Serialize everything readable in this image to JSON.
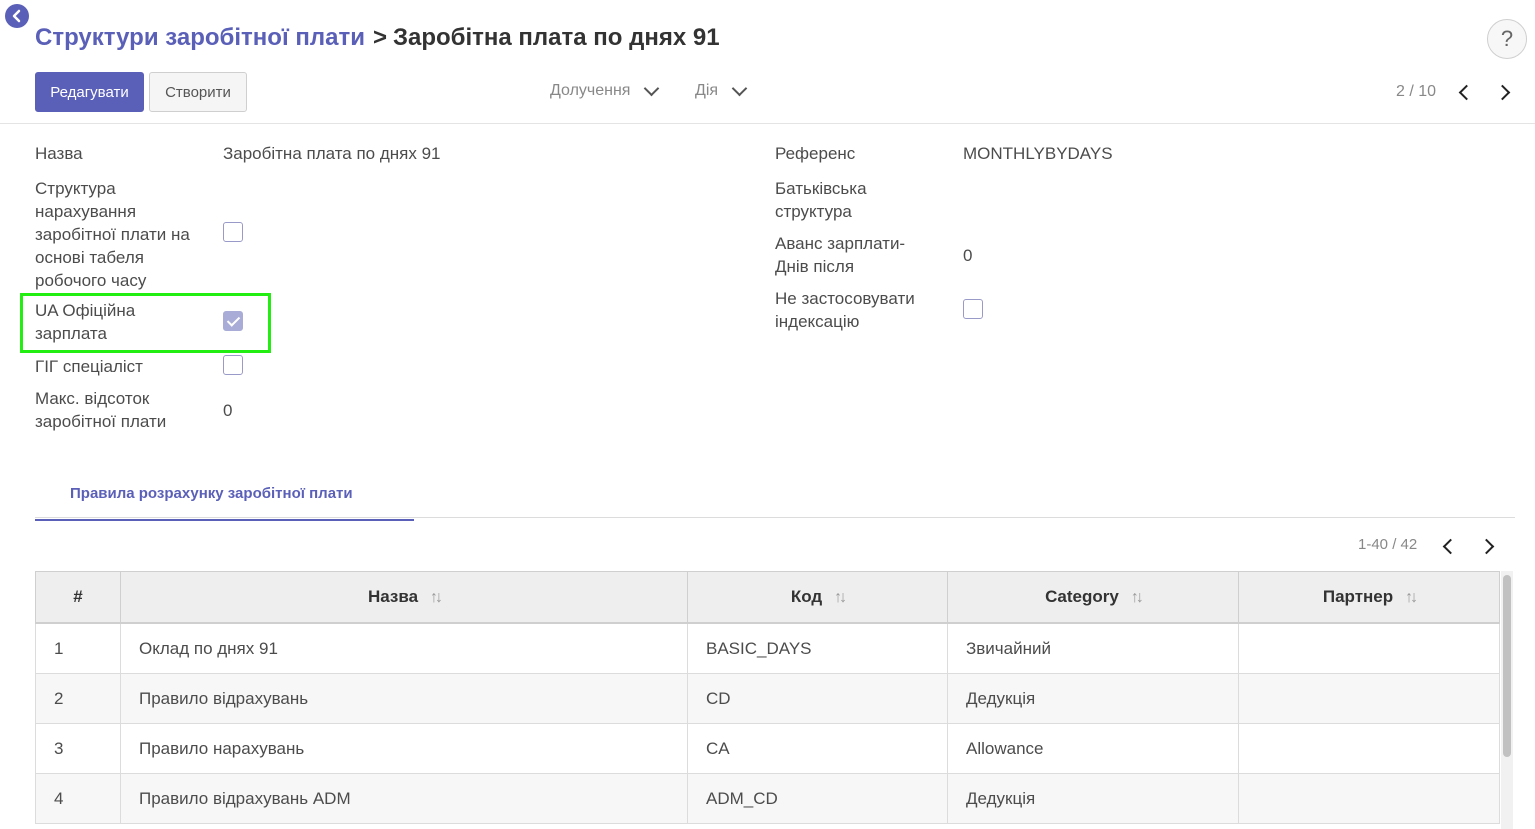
{
  "header": {
    "breadcrumb_parent": "Структури заробітної плати",
    "breadcrumb_sep": ">",
    "breadcrumb_current": "Заробітна плата по днях 91",
    "help": "?"
  },
  "toolbar": {
    "edit_label": "Редагувати",
    "create_label": "Створити",
    "attachments_label": "Долучення",
    "action_label": "Дія",
    "pager": "2 / 10"
  },
  "form": {
    "name_label": "Назва",
    "name_value": "Заробітна плата по днях 91",
    "timesheet_label": "Структура нарахування заробітної плати на основі табеля робочого часу",
    "timesheet_checked": false,
    "ua_official_label": "UA Офіційна зарплата",
    "ua_official_checked": true,
    "gig_label": "ГІГ спеціаліст",
    "gig_checked": false,
    "max_percent_label": "Макс. відсоток заробітної плати",
    "max_percent_value": "0",
    "reference_label": "Референс",
    "reference_value": "MONTHLYBYDAYS",
    "parent_label": "Батьківська структура",
    "parent_value": "",
    "advance_label": "Аванс зарплати-Днів після",
    "advance_value": "0",
    "no_indexation_label": "Не застосовувати індексацію",
    "no_indexation_checked": false
  },
  "tabs": [
    {
      "label": "Правила розрахунку заробітної плати",
      "active": true
    }
  ],
  "table": {
    "pager": "1-40 / 42",
    "columns": [
      "#",
      "Назва",
      "Код",
      "Category",
      "Партнер"
    ],
    "rows": [
      {
        "num": "1",
        "name": "Оклад по днях 91",
        "code": "BASIC_DAYS",
        "category": "Звичайний",
        "partner": ""
      },
      {
        "num": "2",
        "name": "Правило відрахувань",
        "code": "CD",
        "category": "Дедукція",
        "partner": ""
      },
      {
        "num": "3",
        "name": "Правило нарахувань",
        "code": "CA",
        "category": "Allowance",
        "partner": ""
      },
      {
        "num": "4",
        "name": "Правило відрахувань ADM",
        "code": "ADM_CD",
        "category": "Дедукція",
        "partner": ""
      }
    ]
  },
  "colors": {
    "accent": "#5a5fb8",
    "highlight": "#22ee11"
  },
  "icons": {
    "back": "back-arrow-circle-icon",
    "help": "question-icon",
    "sort": "sort-arrows-icon"
  }
}
